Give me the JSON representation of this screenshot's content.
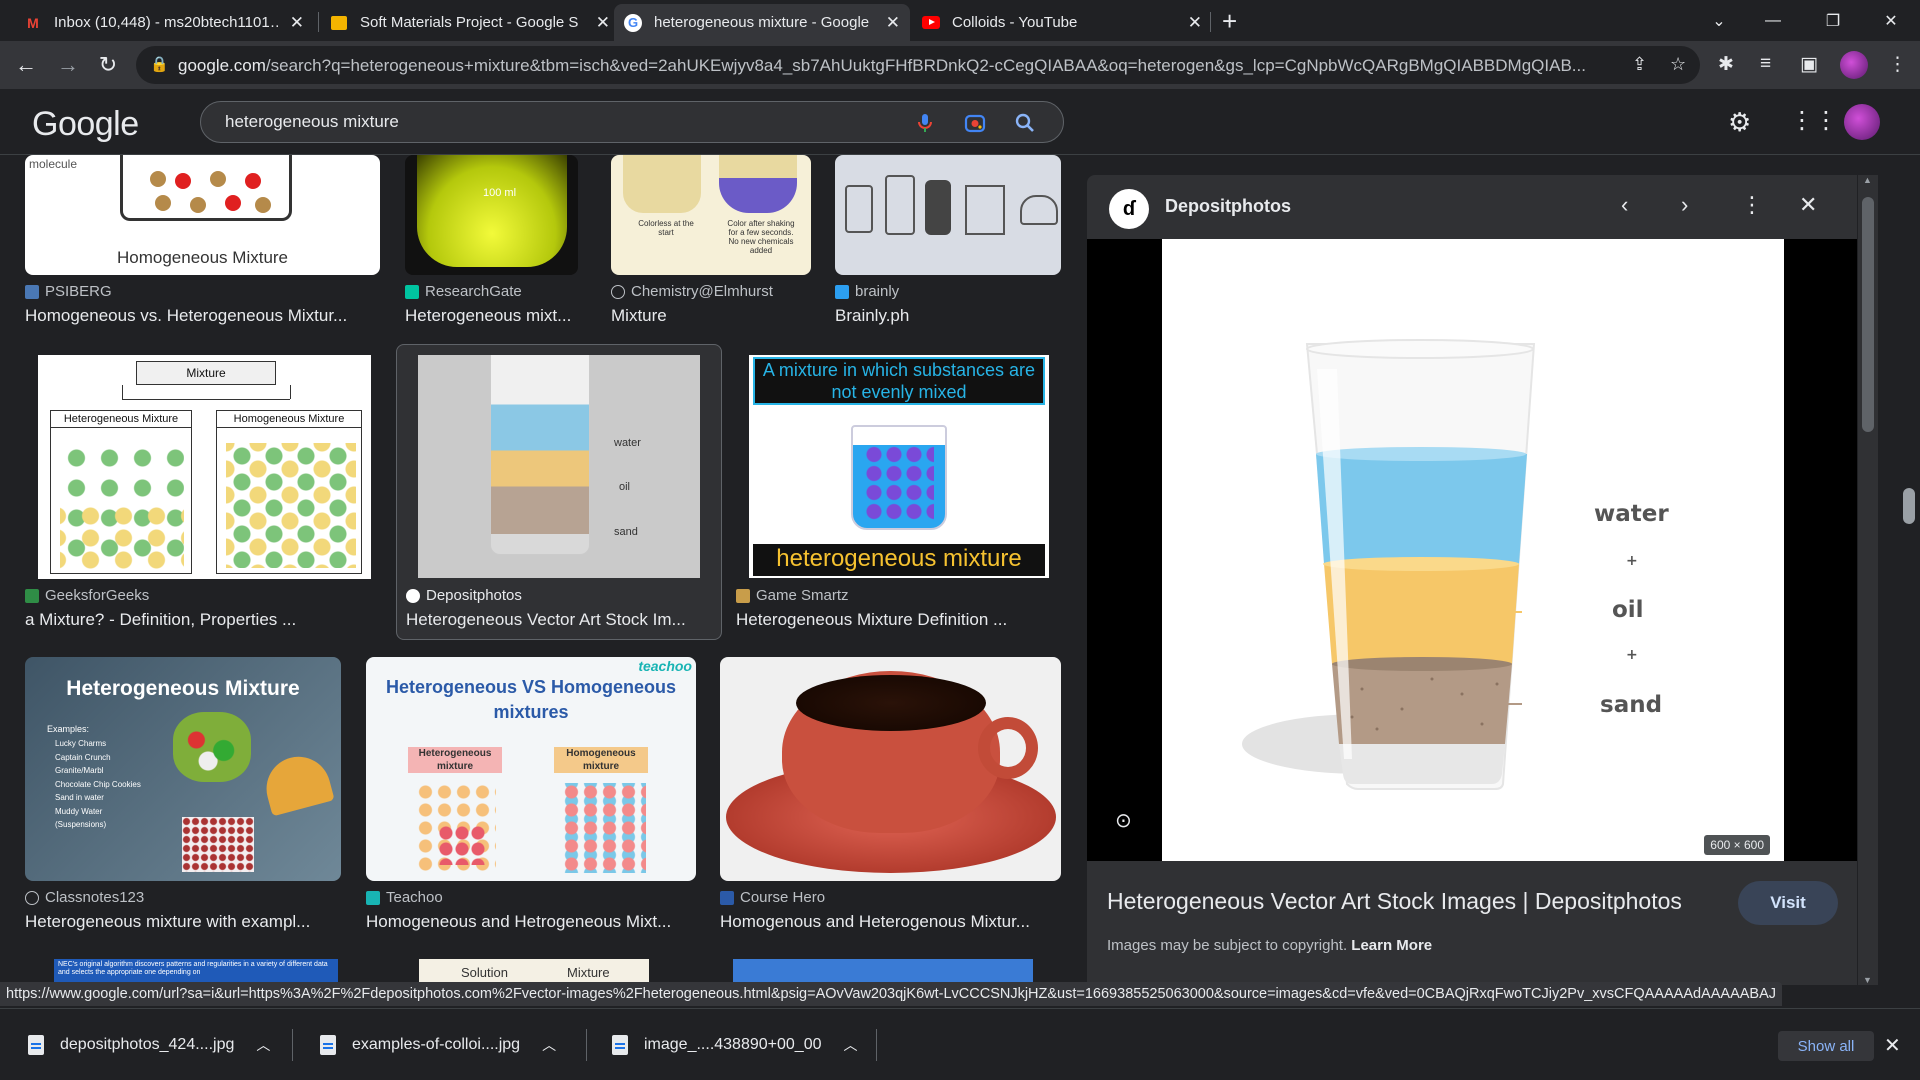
{
  "tabs": [
    {
      "title": "Inbox (10,448) - ms20btech1101…",
      "favicon": "gmail-icon",
      "active": false
    },
    {
      "title": "Soft Materials Project - Google S",
      "favicon": "slides-icon",
      "active": false
    },
    {
      "title": "heterogeneous mixture - Google",
      "favicon": "google-icon",
      "active": true
    },
    {
      "title": "Colloids - YouTube",
      "favicon": "youtube-icon",
      "active": false
    }
  ],
  "address_bar": {
    "domain": "google.com",
    "path": "/search?q=heterogeneous+mixture&tbm=isch&ved=2ahUKEwjyv8a4_sb7AhUuktgFHfBRDnkQ2-cCegQIABAA&oq=heterogen&gs_lcp=CgNpbWcQARgBMgQIABBDMgQIAB..."
  },
  "google": {
    "logo": "Google",
    "query": "heterogeneous mixture"
  },
  "results": [
    {
      "source": "PSIBERG",
      "title": "Homogeneous vs. Heterogeneous Mixtur...",
      "thumb_text": "Homogeneous Mixture",
      "thumb_sub": "molecule"
    },
    {
      "source": "ResearchGate",
      "title": "Heterogeneous mixt...",
      "thumb_text": "100 ml"
    },
    {
      "source": "Chemistry@Elmhurst",
      "title": "Mixture",
      "thumb_text": "Colorless at the start",
      "thumb_sub": "Color after shaking for a few seconds. No new chemicals added"
    },
    {
      "source": "brainly",
      "title": "Brainly.ph"
    },
    {
      "source": "GeeksforGeeks",
      "title": "a Mixture? - Definition, Properties ...",
      "thumb_text": "Mixture",
      "thumb_left": "Heterogeneous Mixture",
      "thumb_right": "Homogeneous Mixture"
    },
    {
      "source": "Depositphotos",
      "title": "Heterogeneous Vector Art Stock Im...",
      "labels": [
        "water",
        "oil",
        "sand"
      ]
    },
    {
      "source": "Game Smartz",
      "title": "Heterogeneous Mixture Definition ...",
      "thumb_top": "A mixture in which substances are not evenly mixed",
      "thumb_bottom": "heterogeneous mixture"
    },
    {
      "source": "Classnotes123",
      "title": "Heterogeneous mixture with exampl...",
      "thumb_text": "Heterogeneous Mixture",
      "examples_label": "Examples:",
      "examples": [
        "Lucky Charms",
        "Captain Crunch",
        "Granite/Marbl",
        "Chocolate Chip Cookies",
        "Sand in water",
        "Muddy Water",
        "(Suspensions)"
      ]
    },
    {
      "source": "Teachoo",
      "title": "Homogeneous and Hetrogeneous Mixt...",
      "thumb_text": "Heterogeneous VS Homogeneous mixtures",
      "brand": "teachoo",
      "left_tag": "Heterogeneous mixture",
      "right_tag": "Homogeneous mixture"
    },
    {
      "source": "Course Hero",
      "title": "Homogenous and Heterogenous Mixtur..."
    }
  ],
  "panel": {
    "site": "Depositphotos",
    "title": "Heterogeneous Vector Art Stock Images | Depositphotos",
    "visit": "Visit",
    "copyright": "Images may be subject to copyright.",
    "learn_more": "Learn More",
    "dims": "600 × 600",
    "labels": [
      "water",
      "+",
      "oil",
      "+",
      "sand"
    ]
  },
  "bottom_peek": {
    "left": "NEC's original algorithm discovers patterns and regularities in a variety of different data and selects the appropriate one depending on",
    "mid_left": "Solution",
    "mid_right": "Mixture"
  },
  "status_url": "https://www.google.com/url?sa=i&url=https%3A%2F%2Fdepositphotos.com%2Fvector-images%2Fheterogeneous.html&psig=AOvVaw203qjK6wt-LvCCCSNJkjHZ&ust=1669385525063000&source=images&cd=vfe&ved=0CBAQjRxqFwoTCJiy2Pv_xvsCFQAAAAAdAAAAABAJ",
  "downloads": [
    {
      "name": "depositphotos_424....jpg"
    },
    {
      "name": "examples-of-colloi....jpg"
    },
    {
      "name": "image_....438890+00_00"
    }
  ],
  "show_all": "Show all",
  "colors": {
    "bg": "#202124",
    "toolbar": "#35363a",
    "panel": "#303134",
    "link": "#8ab4f8",
    "water": "#7cc8ec",
    "oil": "#f6c768",
    "sand": "#b39a86"
  }
}
